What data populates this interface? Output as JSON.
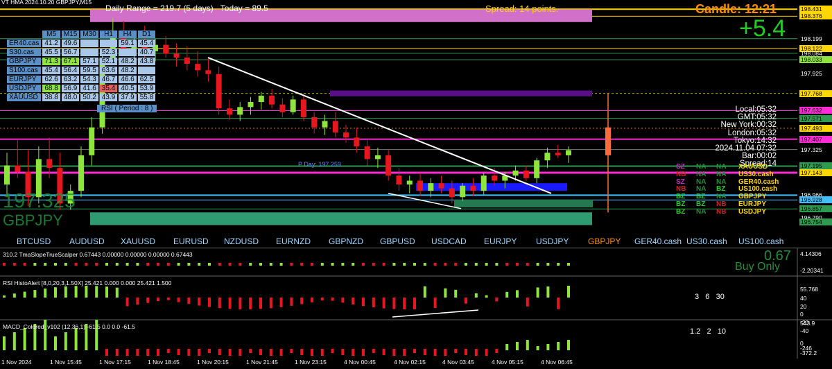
{
  "chart_data": {
    "type": "candlestick",
    "symbol_title": "GBPJPY,M15",
    "header_fragment": "VT HMA 2024.10.20",
    "daily_range_text": "Daily Range = 219.7 (5 days)",
    "today_text": "Today = 89.5",
    "spread_text": "Spread: 14 points.",
    "candle_timer": "Candle:  12:21",
    "pnl": "+5.4",
    "bid_overlay": "197.325",
    "symbol_overlay": "GBPJPY",
    "pday_label": "P Day: 197.259",
    "rsi_label": "RSI ( Period : 8 )",
    "price_axis": [
      "198.431",
      "198.376",
      "198.199",
      "198.122",
      "198.084",
      "198.033",
      "197.925",
      "197.768",
      "197.632",
      "197.571",
      "197.493",
      "197.407",
      "197.325",
      "197.195",
      "197.143",
      "196.966",
      "196.928",
      "196.857",
      "196.790",
      "196.754"
    ],
    "time_axis": [
      "1 Nov 2024",
      "1 Nov 15:45",
      "1 Nov 17:15",
      "1 Nov 18:45",
      "1 Nov 20:15",
      "1 Nov 21:45",
      "1 Nov 23:15",
      "4 Nov 00:45",
      "4 Nov 02:15",
      "4 Nov 03:45",
      "4 Nov 05:15",
      "4 Nov 06:45"
    ],
    "ylim": [
      196.7,
      198.46
    ],
    "candles": [
      {
        "o": 197.05,
        "h": 197.3,
        "l": 196.95,
        "c": 197.2
      },
      {
        "o": 197.2,
        "h": 197.4,
        "l": 197.1,
        "c": 197.15
      },
      {
        "o": 197.15,
        "h": 197.32,
        "l": 196.88,
        "c": 196.95
      },
      {
        "o": 196.95,
        "h": 197.35,
        "l": 196.9,
        "c": 197.25
      },
      {
        "o": 197.25,
        "h": 197.42,
        "l": 197.1,
        "c": 197.18
      },
      {
        "o": 197.18,
        "h": 197.3,
        "l": 196.85,
        "c": 196.9
      },
      {
        "o": 196.9,
        "h": 197.05,
        "l": 196.85,
        "c": 197.0
      },
      {
        "o": 197.0,
        "h": 197.35,
        "l": 196.95,
        "c": 197.28
      },
      {
        "o": 197.28,
        "h": 197.58,
        "l": 197.2,
        "c": 197.5
      },
      {
        "o": 197.5,
        "h": 198.1,
        "l": 197.45,
        "c": 198.05
      },
      {
        "o": 198.05,
        "h": 198.36,
        "l": 198.0,
        "c": 198.22
      },
      {
        "o": 198.22,
        "h": 198.34,
        "l": 198.08,
        "c": 198.12
      },
      {
        "o": 198.12,
        "h": 198.25,
        "l": 198.0,
        "c": 198.18
      },
      {
        "o": 198.18,
        "h": 198.3,
        "l": 198.05,
        "c": 198.1
      },
      {
        "o": 198.1,
        "h": 198.2,
        "l": 198.02,
        "c": 198.15
      },
      {
        "o": 198.15,
        "h": 198.22,
        "l": 198.05,
        "c": 198.08
      },
      {
        "o": 198.08,
        "h": 198.16,
        "l": 197.98,
        "c": 198.05
      },
      {
        "o": 198.05,
        "h": 198.14,
        "l": 197.95,
        "c": 198.0
      },
      {
        "o": 198.0,
        "h": 198.1,
        "l": 197.9,
        "c": 197.95
      },
      {
        "o": 197.95,
        "h": 198.04,
        "l": 197.86,
        "c": 197.92
      },
      {
        "o": 197.92,
        "h": 197.98,
        "l": 197.6,
        "c": 197.65
      },
      {
        "o": 197.65,
        "h": 197.72,
        "l": 197.56,
        "c": 197.6
      },
      {
        "o": 197.6,
        "h": 197.7,
        "l": 197.55,
        "c": 197.66
      },
      {
        "o": 197.66,
        "h": 197.74,
        "l": 197.6,
        "c": 197.7
      },
      {
        "o": 197.7,
        "h": 197.78,
        "l": 197.64,
        "c": 197.75
      },
      {
        "o": 197.75,
        "h": 197.8,
        "l": 197.65,
        "c": 197.68
      },
      {
        "o": 197.68,
        "h": 197.73,
        "l": 197.58,
        "c": 197.62
      },
      {
        "o": 197.62,
        "h": 197.75,
        "l": 197.6,
        "c": 197.72
      },
      {
        "o": 197.72,
        "h": 197.76,
        "l": 197.55,
        "c": 197.58
      },
      {
        "o": 197.58,
        "h": 197.62,
        "l": 197.45,
        "c": 197.5
      },
      {
        "o": 197.5,
        "h": 197.6,
        "l": 197.44,
        "c": 197.55
      },
      {
        "o": 197.55,
        "h": 197.62,
        "l": 197.42,
        "c": 197.46
      },
      {
        "o": 197.46,
        "h": 197.52,
        "l": 197.38,
        "c": 197.42
      },
      {
        "o": 197.42,
        "h": 197.5,
        "l": 197.3,
        "c": 197.35
      },
      {
        "o": 197.35,
        "h": 197.4,
        "l": 197.2,
        "c": 197.25
      },
      {
        "o": 197.25,
        "h": 197.34,
        "l": 197.18,
        "c": 197.28
      },
      {
        "o": 197.28,
        "h": 197.32,
        "l": 197.08,
        "c": 197.12
      },
      {
        "o": 197.12,
        "h": 197.18,
        "l": 197.0,
        "c": 197.05
      },
      {
        "o": 197.05,
        "h": 197.12,
        "l": 196.98,
        "c": 197.08
      },
      {
        "o": 197.08,
        "h": 197.14,
        "l": 196.96,
        "c": 197.0
      },
      {
        "o": 197.0,
        "h": 197.1,
        "l": 196.95,
        "c": 197.06
      },
      {
        "o": 197.06,
        "h": 197.12,
        "l": 196.98,
        "c": 197.02
      },
      {
        "o": 197.02,
        "h": 197.08,
        "l": 196.9,
        "c": 196.95
      },
      {
        "o": 196.95,
        "h": 197.06,
        "l": 196.92,
        "c": 197.04
      },
      {
        "o": 197.04,
        "h": 197.1,
        "l": 196.96,
        "c": 197.0
      },
      {
        "o": 197.0,
        "h": 197.14,
        "l": 196.97,
        "c": 197.12
      },
      {
        "o": 197.12,
        "h": 197.18,
        "l": 197.04,
        "c": 197.08
      },
      {
        "o": 197.08,
        "h": 197.15,
        "l": 197.02,
        "c": 197.12
      },
      {
        "o": 197.12,
        "h": 197.2,
        "l": 197.08,
        "c": 197.16
      },
      {
        "o": 197.16,
        "h": 197.2,
        "l": 197.08,
        "c": 197.1
      },
      {
        "o": 197.1,
        "h": 197.26,
        "l": 197.06,
        "c": 197.24
      },
      {
        "o": 197.24,
        "h": 197.34,
        "l": 197.18,
        "c": 197.3
      },
      {
        "o": 197.3,
        "h": 197.36,
        "l": 197.26,
        "c": 197.28
      },
      {
        "o": 197.28,
        "h": 197.35,
        "l": 197.22,
        "c": 197.32
      }
    ],
    "indicator_panels": [
      {
        "name": "310.2 TmaSlopeTrueScalper 0.67443 0.00000 0.00000 0.00000 0.67443",
        "axis": [
          "4.14306",
          "-2.20341"
        ],
        "value": "0.67",
        "signal": "Buy Only"
      },
      {
        "name": "RSI HistoAlert [8,0,20,3,1.50X] 25.421 0.000 0.000 25.421 1.500",
        "axis": [
          "55.768",
          "40",
          "20",
          "0",
          "-20",
          "-40"
        ],
        "numbers": "3   6   30"
      },
      {
        "name": "MACD_Colored_v102 (12,36,1) -61.5 0.0 0.0 -61.5",
        "axis": [
          "543.9",
          "0",
          "-246",
          "-372.2"
        ],
        "numbers": "1.2   2   10"
      }
    ]
  },
  "timeframes": [
    "M5",
    "M15",
    "M30",
    "H1",
    "H4",
    "D1"
  ],
  "tf_rows": [
    {
      "sym": "ER40.cas",
      "vals": [
        "41.2",
        "49.6",
        "",
        "",
        "59.1",
        "45.4"
      ]
    },
    {
      "sym": "S30.cas",
      "vals": [
        "45.5",
        "56.7",
        "",
        "52.3",
        "",
        "40.7"
      ]
    },
    {
      "sym": "GBPJPY",
      "vals": [
        "71.3",
        "67.1",
        "57.1",
        "52.1",
        "48.2",
        "43.8"
      ]
    },
    {
      "sym": "S100.cas",
      "vals": [
        "45.4",
        "56.4",
        "59.5",
        "63.6",
        "48.2",
        ""
      ]
    },
    {
      "sym": "EURJPY",
      "vals": [
        "62.6",
        "63.2",
        "54.3",
        "46.7",
        "46.6",
        "62.5"
      ]
    },
    {
      "sym": "USDJPY",
      "vals": [
        "68.8",
        "56.9",
        "41.6",
        "35.4",
        "40.5",
        "53.9"
      ]
    },
    {
      "sym": "XAUUSD",
      "vals": [
        "38.8",
        "48.0",
        "50.2",
        "43.9",
        "37.9",
        "55.8"
      ]
    }
  ],
  "pairs": [
    "BTCUSD",
    "AUDUSD",
    "XAUUSD",
    "EURUSD",
    "NZDUSD",
    "EURNZD",
    "GBPNZD",
    "GBPUSD",
    "USDCAD",
    "EURJPY",
    "USDJPY",
    "GBPJPY",
    "GER40.cash",
    "US30.cash",
    "US100.cash"
  ],
  "session_info": [
    "Local:05:32",
    "GMT:05:32",
    "New York:00:32",
    "London:05:32",
    "Tokyo:14:32",
    "2024.11.04 07:32",
    "Bar:00:02",
    "Spread:14"
  ],
  "status_rows": [
    {
      "a": "SZ",
      "b": "NA",
      "c": "NA",
      "sym": "XAUUSD"
    },
    {
      "a": "NB",
      "b": "NA",
      "c": "NA",
      "sym": "US30.cash"
    },
    {
      "a": "SZ",
      "b": "NA",
      "c": "NA",
      "sym": "GER40.cash"
    },
    {
      "a": "NB",
      "b": "NA",
      "c": "BZ",
      "sym": "US100.cash"
    },
    {
      "a": "BZ",
      "b": "BZ",
      "c": "NA",
      "sym": "GBPJPY"
    },
    {
      "a": "BZ",
      "b": "BZ",
      "c": "NB",
      "sym": "EURJPY"
    },
    {
      "a": "BZ",
      "b": "NA",
      "c": "NB",
      "sym": "USDJPY"
    }
  ],
  "colors": {
    "bull": "#8ee63c",
    "bear": "#e8171f",
    "magenta": "#ff2bd6",
    "gold": "#ffd700",
    "teal": "#2e9b70",
    "blue": "#1a1aff",
    "purple": "#5a0f8a"
  }
}
